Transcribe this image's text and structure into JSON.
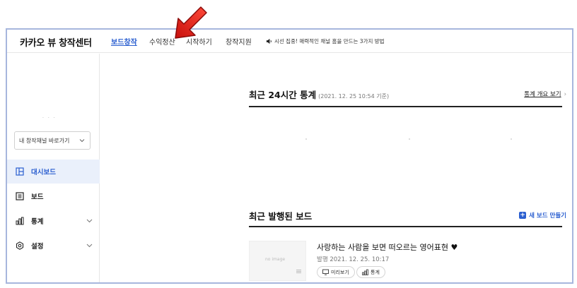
{
  "app": {
    "title": "카카오 뷰 창작센터"
  },
  "nav": {
    "items": [
      {
        "label": "보드창작",
        "active": true
      },
      {
        "label": "수익정산",
        "active": false
      },
      {
        "label": "시작하기",
        "active": false
      },
      {
        "label": "창작지원",
        "active": false
      }
    ],
    "notice": "시선 집중! 매력적인 채널 홈을 만드는 3가지 방법",
    "notice_icon": "speaker-icon"
  },
  "sidebar": {
    "channel_select": "내 창작채널 바로가기",
    "items": [
      {
        "label": "대시보드",
        "icon": "dashboard-icon",
        "active": true
      },
      {
        "label": "보드",
        "icon": "board-icon",
        "active": false
      },
      {
        "label": "통계",
        "icon": "stats-icon",
        "active": false,
        "expandable": true
      },
      {
        "label": "설정",
        "icon": "settings-icon",
        "active": false,
        "expandable": true
      }
    ]
  },
  "main": {
    "stats": {
      "title": "최근 24시간 통계",
      "subtitle": "(2021. 12. 25 10:54 기준)",
      "link": "통계 개요 보기",
      "link_arrow": "›"
    },
    "recent": {
      "title": "최근 발행된 보드",
      "new_button": "새 보드 만들기",
      "post": {
        "thumb_text": "no image",
        "title": "사랑하는 사람을 보면 떠오르는 영어표현 ♥",
        "meta": "발행 2021. 12. 25. 10:17",
        "preview_button": "미리보기",
        "stats_button": "통계"
      }
    }
  },
  "colors": {
    "accent": "#2b5fd0",
    "active_bg": "#eaf0fb",
    "annotation_arrow": "#e8201a"
  }
}
